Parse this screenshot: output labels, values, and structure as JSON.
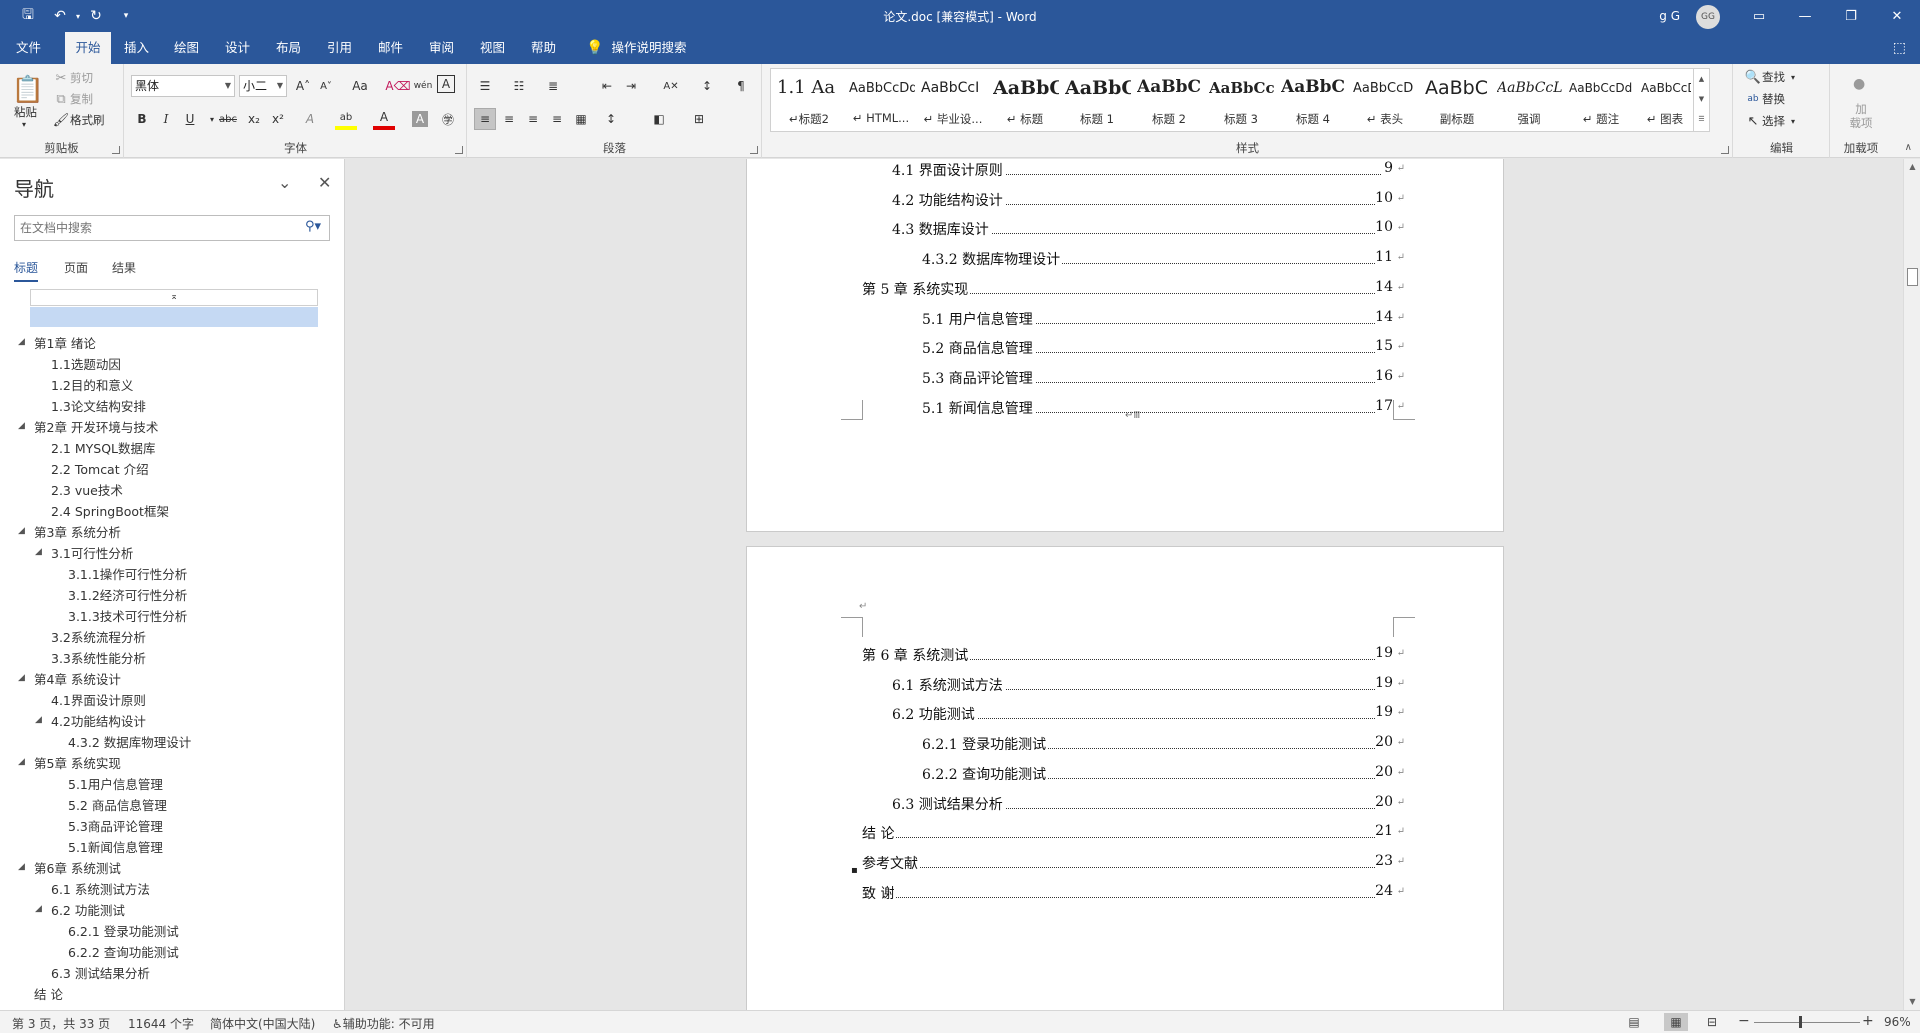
{
  "titlebar": {
    "title": "论文.doc  [兼容模式]  -  Word",
    "user": "g G",
    "avatar": "GG",
    "qa_icons": [
      "save-icon",
      "undo-icon",
      "redo-icon",
      "customize-icon"
    ],
    "save_glyph": "🖫",
    "undo_glyph": "↶",
    "redo_glyph": "↻",
    "customize_glyph": "▾",
    "ribbon_display_glyph": "▭",
    "minimize_glyph": "—",
    "restore_glyph": "❐",
    "close_glyph": "✕"
  },
  "menu": {
    "tabs": [
      "文件",
      "开始",
      "插入",
      "绘图",
      "设计",
      "布局",
      "引用",
      "邮件",
      "审阅",
      "视图",
      "帮助"
    ],
    "active": "开始",
    "tellme": "操作说明搜索",
    "bulb_glyph": "💡",
    "share_glyph": "⬚"
  },
  "ribbon": {
    "clipboard": {
      "label": "剪贴板",
      "paste": "粘贴",
      "paste_glyph": "📋",
      "cut": "剪切",
      "copy": "复制",
      "format_painter": "格式刷",
      "cut_glyph": "✂",
      "copy_glyph": "⧉",
      "painter_glyph": "🖌"
    },
    "font": {
      "label": "字体",
      "font_name": "黑体",
      "font_size": "小二",
      "grow": "A˄",
      "shrink": "A˅",
      "case": "Aa",
      "clear": "A⌫",
      "phonetic": "wén",
      "border_char": "A",
      "bold": "B",
      "italic": "I",
      "underline": "U",
      "strike": "abc",
      "sub": "x₂",
      "sup": "x²",
      "effects": "A",
      "highlight": "ab",
      "color": "A",
      "shade": "A",
      "enclose": "㊫"
    },
    "paragraph": {
      "label": "段落",
      "glyphs": [
        "☰",
        "☷",
        "≣",
        "⇤",
        "⇥",
        "A✕",
        "↕",
        "¶",
        "≡",
        "≡",
        "≡",
        "≡",
        "▦",
        "↕",
        "◧",
        "⊞"
      ]
    },
    "styles": {
      "label": "样式",
      "items": [
        {
          "sample": "1.1  Aa",
          "name": "↵标题2"
        },
        {
          "sample": "AaBbCcDd",
          "name": "↵ HTML..."
        },
        {
          "sample": "AaBbCcI",
          "name": "↵ 毕业设..."
        },
        {
          "sample": "AaBbC",
          "name": "↵ 标题"
        },
        {
          "sample": "AaBbC",
          "name": "标题 1"
        },
        {
          "sample": "AaBbC",
          "name": "标题 2"
        },
        {
          "sample": "AaBbCcl",
          "name": "标题 3"
        },
        {
          "sample": "AaBbC",
          "name": "标题 4"
        },
        {
          "sample": "AaBbCcD",
          "name": "↵ 表头"
        },
        {
          "sample": "AaBbC",
          "name": "副标题"
        },
        {
          "sample": "AaBbCcL",
          "name": "强调"
        },
        {
          "sample": "AaBbCcDd",
          "name": "↵ 题注"
        },
        {
          "sample": "AaBbCcD",
          "name": "↵ 图表"
        }
      ]
    },
    "editing": {
      "label": "编辑",
      "find": "查找",
      "replace": "替换",
      "select": "选择",
      "find_glyph": "🔍",
      "replace_glyph": "ab",
      "select_glyph": "↖"
    },
    "addins": {
      "label": "加载项",
      "text": "加\n载项",
      "glyph": "●"
    }
  },
  "nav": {
    "title": "导航",
    "search_placeholder": "在文档中搜索",
    "tabs": [
      "标题",
      "页面",
      "结果"
    ],
    "collapse_glyph": "⌅",
    "items": [
      {
        "level": 0,
        "arrow": "◢",
        "text": "第1章 绪论"
      },
      {
        "level": 1,
        "arrow": "",
        "text": "1.1选题动因"
      },
      {
        "level": 1,
        "arrow": "",
        "text": "1.2目的和意义"
      },
      {
        "level": 1,
        "arrow": "",
        "text": "1.3论文结构安排"
      },
      {
        "level": 0,
        "arrow": "◢",
        "text": "第2章 开发环境与技术"
      },
      {
        "level": 1,
        "arrow": "",
        "text": "2.1 MYSQL数据库"
      },
      {
        "level": 1,
        "arrow": "",
        "text": "2.2 Tomcat 介绍"
      },
      {
        "level": 1,
        "arrow": "",
        "text": "2.3 vue技术"
      },
      {
        "level": 1,
        "arrow": "",
        "text": "2.4 SpringBoot框架"
      },
      {
        "level": 0,
        "arrow": "◢",
        "text": "第3章 系统分析"
      },
      {
        "level": 1,
        "arrow": "◢",
        "text": "3.1可行性分析"
      },
      {
        "level": 2,
        "arrow": "",
        "text": "3.1.1操作可行性分析"
      },
      {
        "level": 2,
        "arrow": "",
        "text": "3.1.2经济可行性分析"
      },
      {
        "level": 2,
        "arrow": "",
        "text": "3.1.3技术可行性分析"
      },
      {
        "level": 1,
        "arrow": "",
        "text": "3.2系统流程分析"
      },
      {
        "level": 1,
        "arrow": "",
        "text": "3.3系统性能分析"
      },
      {
        "level": 0,
        "arrow": "◢",
        "text": "第4章 系统设计"
      },
      {
        "level": 1,
        "arrow": "",
        "text": "4.1界面设计原则"
      },
      {
        "level": 1,
        "arrow": "◢",
        "text": "4.2功能结构设计"
      },
      {
        "level": 2,
        "arrow": "",
        "text": "4.3.2 数据库物理设计"
      },
      {
        "level": 0,
        "arrow": "◢",
        "text": "第5章 系统实现"
      },
      {
        "level": 2,
        "arrow": "",
        "text": "5.1用户信息管理"
      },
      {
        "level": 2,
        "arrow": "",
        "text": "5.2 商品信息管理"
      },
      {
        "level": 2,
        "arrow": "",
        "text": "5.3商品评论管理"
      },
      {
        "level": 2,
        "arrow": "",
        "text": "5.1新闻信息管理"
      },
      {
        "level": 0,
        "arrow": "◢",
        "text": "第6章 系统测试"
      },
      {
        "level": 1,
        "arrow": "",
        "text": "6.1 系统测试方法"
      },
      {
        "level": 1,
        "arrow": "◢",
        "text": "6.2 功能测试"
      },
      {
        "level": 2,
        "arrow": "",
        "text": "6.2.1 登录功能测试"
      },
      {
        "level": 2,
        "arrow": "",
        "text": "6.2.2 查询功能测试"
      },
      {
        "level": 1,
        "arrow": "",
        "text": "6.3 测试结果分析"
      },
      {
        "level": 0,
        "arrow": "",
        "text": "结  论"
      }
    ]
  },
  "doc": {
    "page1_toc": [
      {
        "level": 1,
        "text": "4.1 界面设计原则",
        "page": "9"
      },
      {
        "level": 1,
        "text": "4.2 功能结构设计",
        "page": "10"
      },
      {
        "level": 1,
        "text": "4.3 数据库设计",
        "page": "10"
      },
      {
        "level": 2,
        "text": "4.3.2  数据库物理设计",
        "page": "11"
      },
      {
        "level": 0,
        "text": "第 5 章  系统实现",
        "page": "14"
      },
      {
        "level": 2,
        "text": "5.1 用户信息管理",
        "page": "14"
      },
      {
        "level": 2,
        "text": "5.2  商品信息管理",
        "page": "15"
      },
      {
        "level": 2,
        "text": "5.3 商品评论管理",
        "page": "16"
      },
      {
        "level": 2,
        "text": "5.1 新闻信息管理",
        "page": "17"
      }
    ],
    "page2_toc": [
      {
        "level": 0,
        "text": "第 6 章  系统测试",
        "page": "19"
      },
      {
        "level": 1,
        "text": "6.1  系统测试方法",
        "page": "19"
      },
      {
        "level": 1,
        "text": "6.2  功能测试",
        "page": "19"
      },
      {
        "level": 2,
        "text": "6.2.1  登录功能测试",
        "page": "20"
      },
      {
        "level": 2,
        "text": "6.2.2  查询功能测试",
        "page": "20"
      },
      {
        "level": 1,
        "text": "6.3  测试结果分析",
        "page": "20"
      },
      {
        "level": 0,
        "text": "结    论",
        "page": "21"
      },
      {
        "level": 0,
        "text": "参考文献",
        "page": "23"
      },
      {
        "level": 0,
        "text": "致    谢",
        "page": "24"
      }
    ],
    "para_mark": "↵",
    "section_break": "↵Ⅲ",
    "bullet": "▪"
  },
  "status": {
    "page": "第 3 页，共 33 页",
    "words": "11644 个字",
    "language": "简体中文(中国大陆)",
    "accessibility": "辅助功能: 不可用",
    "accessibility_glyph": "♿",
    "zoom_minus": "−",
    "zoom_plus": "+",
    "zoom": "96%",
    "view_glyphs": [
      "▤",
      "▦",
      "⊟"
    ]
  }
}
